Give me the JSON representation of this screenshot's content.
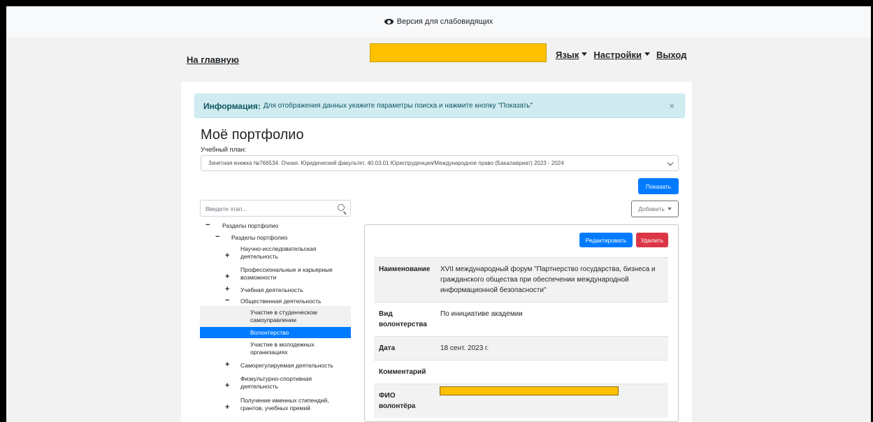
{
  "topbar": {
    "accessibility_label": "Версия для слабовидящих",
    "icon": "eye-icon"
  },
  "nav": {
    "home": "На главную",
    "language": "Язык",
    "settings": "Настройки",
    "logout": "Выход"
  },
  "alert": {
    "title": "Информация:",
    "text": "Для отображения данных укажите параметры поиска и нажмите кнопку \"Показать\"",
    "close": "×"
  },
  "page": {
    "title": "Моё портфолио",
    "plan_label": "Учебный план:",
    "plan_value": "Зачетная книжка №766534. Очная. Юридический факультет. 40.03.01 Юриспруденция/Международное право (Бакалавриат) 2023 - 2024",
    "show_button": "Показать",
    "search_placeholder": "Введите этап...",
    "add_button": "Добавить"
  },
  "tree": {
    "root": "Разделы портфолио",
    "child": "Разделы портфолио",
    "items": [
      {
        "sign": "+",
        "label": "Научно-исследовательская деятельность"
      },
      {
        "sign": "+",
        "label": "Профессиональные и карьерные возможности"
      },
      {
        "sign": "+",
        "label": "Учебная деятельность"
      },
      {
        "sign": "−",
        "label": "Общественная деятельность"
      },
      {
        "sign": "",
        "label": "Участие в студенческом самоуправлении"
      },
      {
        "sign": "",
        "label": "Волонтерство"
      },
      {
        "sign": "",
        "label": "Участие в молодежных организациях"
      },
      {
        "sign": "+",
        "label": "Саморегулируемая деятельность"
      },
      {
        "sign": "+",
        "label": "Физкультурно-спортивная деятельность"
      },
      {
        "sign": "+",
        "label": "Получение именных стипендий, грантов, учебных премий"
      }
    ],
    "selected": "Волонтерство"
  },
  "detail": {
    "edit_button": "Редактировать",
    "delete_button": "Удалить",
    "rows": [
      {
        "key": "Наименование",
        "value": "XVII международный форум \"Партнерство государства, бизнеса и гражданского общества при обеспечении международной информационной безопасности\""
      },
      {
        "key": "Вид волонтерства",
        "value": "По инициативе академии"
      },
      {
        "key": "Дата",
        "value": "18 сент. 2023 г."
      },
      {
        "key": "Комментарий",
        "value": ""
      },
      {
        "key": "ФИО волонтёра",
        "value": ""
      }
    ]
  },
  "colors": {
    "primary": "#007bff",
    "danger": "#dc3545",
    "alert_bg": "#d1ecf1",
    "redaction": "#ffc000"
  }
}
